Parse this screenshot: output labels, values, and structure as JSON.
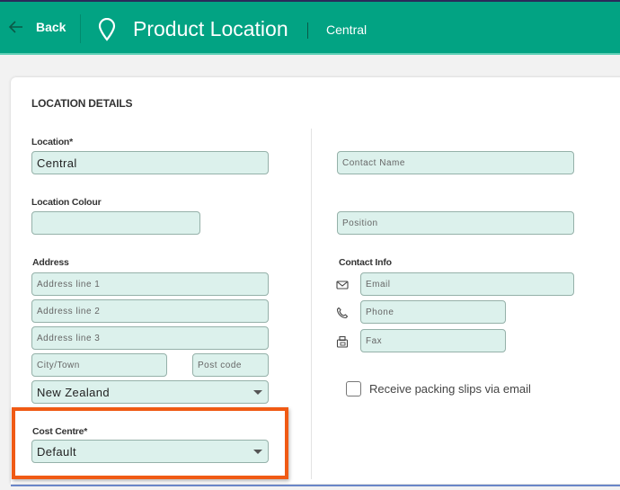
{
  "header": {
    "back_label": "Back",
    "title": "Product Location",
    "subtitle": "Central",
    "color": "#02a383"
  },
  "section": {
    "title": "LOCATION DETAILS"
  },
  "left": {
    "location_label": "Location*",
    "location_value": "Central",
    "colour_label": "Location Colour",
    "colour_value": "",
    "address_label": "Address",
    "address_line1_placeholder": "Address line 1",
    "address_line2_placeholder": "Address line 2",
    "address_line3_placeholder": "Address line 3",
    "city_placeholder": "City/Town",
    "postcode_placeholder": "Post code",
    "country_value": "New Zealand",
    "cost_centre_label": "Cost Centre*",
    "cost_centre_value": "Default"
  },
  "right": {
    "contact_name_placeholder": "Contact Name",
    "position_placeholder": "Position",
    "contact_info_label": "Contact Info",
    "email_placeholder": "Email",
    "phone_placeholder": "Phone",
    "fax_placeholder": "Fax",
    "packing_slips_label": "Receive packing slips via email",
    "packing_slips_checked": false
  },
  "annotation": {
    "highlight_color": "#f05a14",
    "highlight_target": "Cost Centre"
  }
}
